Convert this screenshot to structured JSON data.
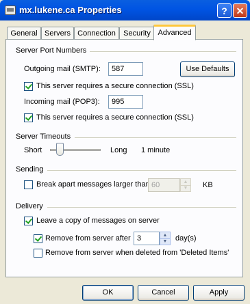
{
  "window": {
    "title": "mx.lukene.ca Properties",
    "help_label": "?",
    "close_label": "✕"
  },
  "tabs": [
    {
      "label": "General",
      "active": false
    },
    {
      "label": "Servers",
      "active": false
    },
    {
      "label": "Connection",
      "active": false
    },
    {
      "label": "Security",
      "active": false
    },
    {
      "label": "Advanced",
      "active": true
    }
  ],
  "server_ports": {
    "group_label": "Server Port Numbers",
    "smtp_label": "Outgoing mail (SMTP):",
    "smtp_value": "587",
    "use_defaults_label": "Use Defaults",
    "smtp_ssl_label": "This server requires a secure connection (SSL)",
    "smtp_ssl_checked": true,
    "pop3_label": "Incoming mail (POP3):",
    "pop3_value": "995",
    "pop3_ssl_label": "This server requires a secure connection (SSL)",
    "pop3_ssl_checked": true
  },
  "timeouts": {
    "group_label": "Server Timeouts",
    "short_label": "Short",
    "long_label": "Long",
    "value_label": "1 minute",
    "slider_level": 0.15
  },
  "sending": {
    "group_label": "Sending",
    "break_apart_label": "Break apart messages larger than",
    "break_apart_checked": false,
    "break_apart_value": "60",
    "unit_label": "KB"
  },
  "delivery": {
    "group_label": "Delivery",
    "leave_copy_label": "Leave a copy of messages on server",
    "leave_copy_checked": true,
    "remove_after_label": "Remove from server after",
    "remove_after_checked": true,
    "remove_after_value": "3",
    "days_label": "day(s)",
    "remove_deleted_label": "Remove from server when deleted from 'Deleted Items'",
    "remove_deleted_checked": false
  },
  "footer": {
    "ok_label": "OK",
    "cancel_label": "Cancel",
    "apply_label": "Apply"
  },
  "colors": {
    "titlebar": "#0054e3",
    "dialog_bg": "#ece9d8",
    "check_mark": "#21a121"
  }
}
